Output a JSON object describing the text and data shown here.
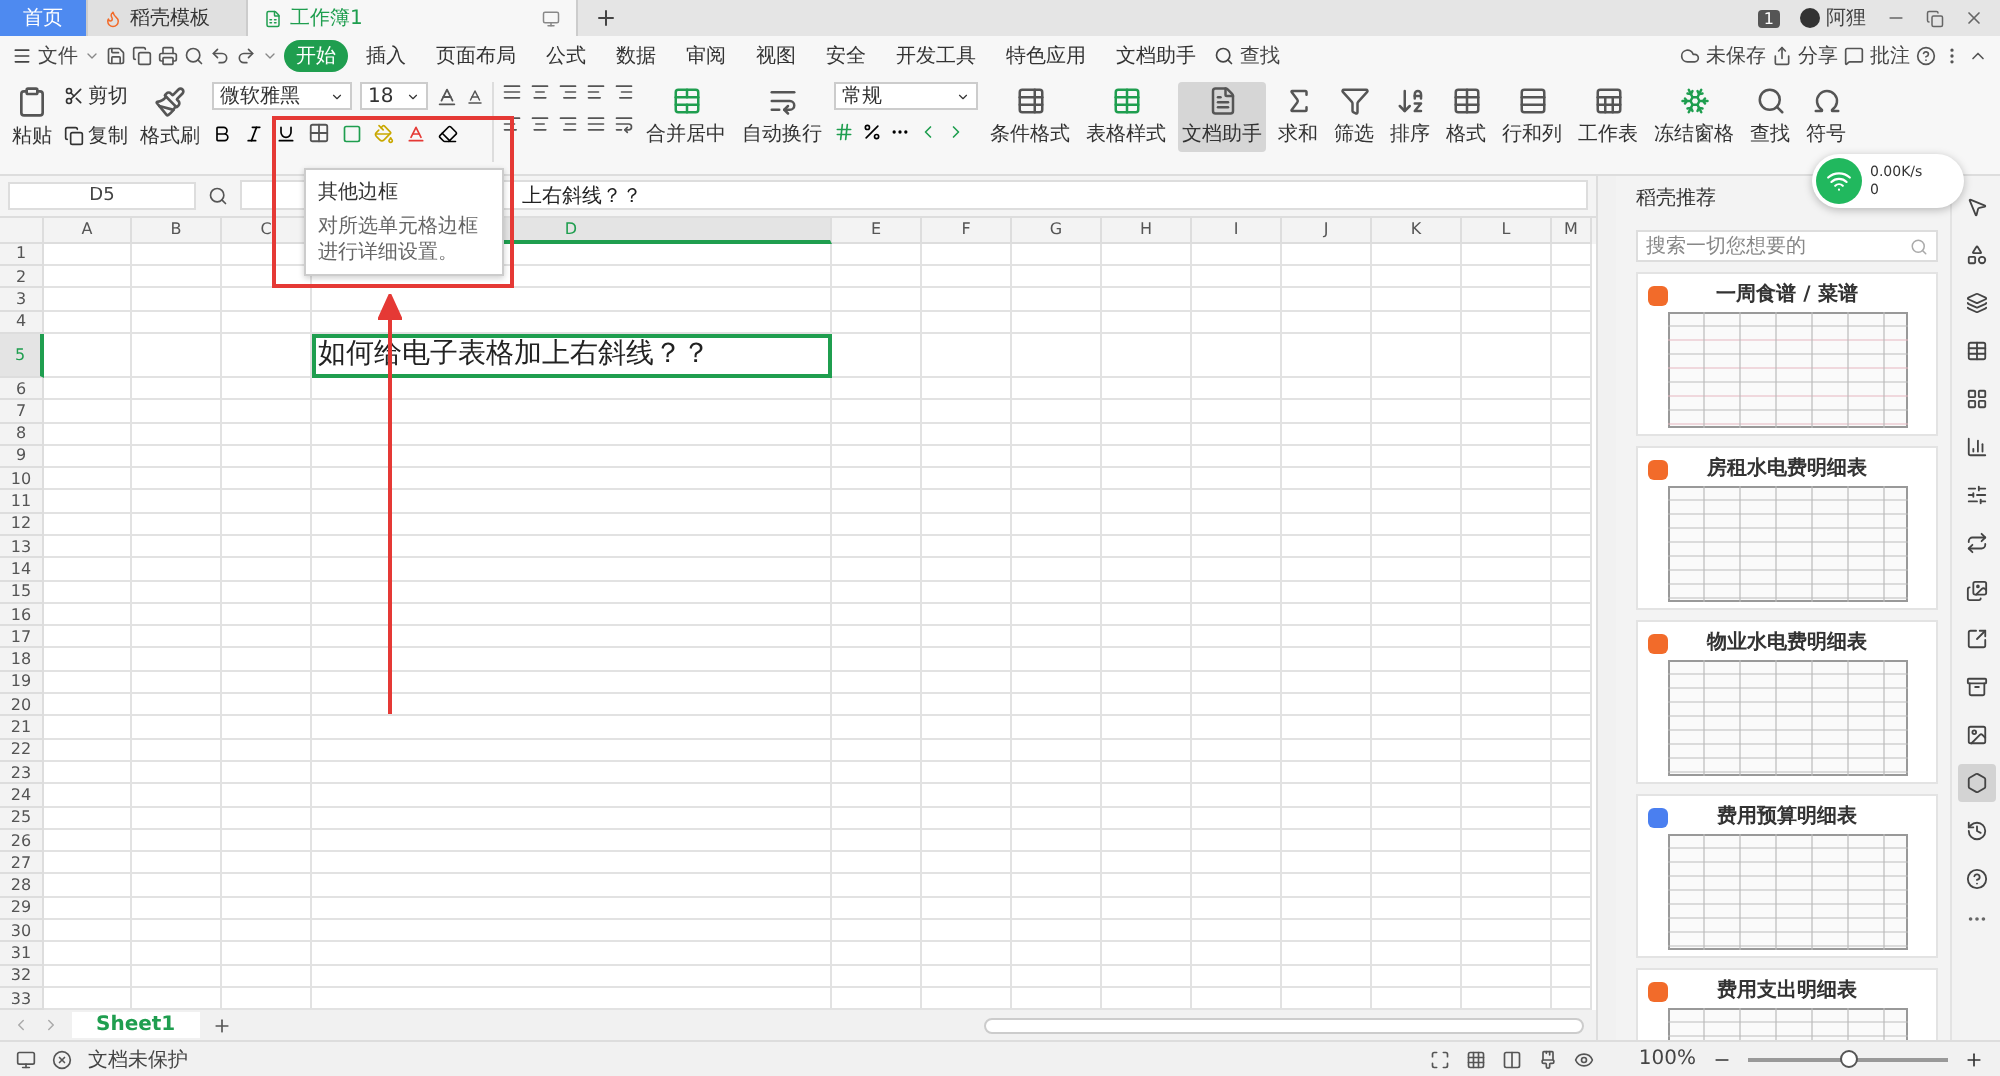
{
  "tabs": [
    {
      "label": "首页",
      "kind": "home",
      "selected": false
    },
    {
      "label": "稻壳模板",
      "kind": "docer",
      "selected": false
    },
    {
      "label": "工作簿1",
      "kind": "sheet",
      "selected": true
    }
  ],
  "account": {
    "badge": "1",
    "user": "阿狸"
  },
  "menu": {
    "file": "文件",
    "items": [
      {
        "label": "开始",
        "selected": true
      },
      {
        "label": "插入",
        "selected": false
      },
      {
        "label": "页面布局",
        "selected": false
      },
      {
        "label": "公式",
        "selected": false
      },
      {
        "label": "数据",
        "selected": false
      },
      {
        "label": "审阅",
        "selected": false
      },
      {
        "label": "视图",
        "selected": false
      },
      {
        "label": "安全",
        "selected": false
      },
      {
        "label": "开发工具",
        "selected": false
      },
      {
        "label": "特色应用",
        "selected": false
      },
      {
        "label": "文档助手",
        "selected": false
      }
    ],
    "search": "查找",
    "save_state": "未保存",
    "share": "分享",
    "comment": "批注"
  },
  "ribbon": {
    "paste": "粘贴",
    "cut": "剪切",
    "copy": "复制",
    "painter": "格式刷",
    "font_family": "微软雅黑",
    "font_size": "18",
    "merge": "合并居中",
    "wrap": "自动换行",
    "number_format": "常规",
    "tools": [
      {
        "label": "条件格式",
        "selected": false
      },
      {
        "label": "表格样式",
        "selected": false
      },
      {
        "label": "文档助手",
        "selected": true
      },
      {
        "label": "求和",
        "selected": false
      },
      {
        "label": "筛选",
        "selected": false
      },
      {
        "label": "排序",
        "selected": false
      },
      {
        "label": "格式",
        "selected": false
      },
      {
        "label": "行和列",
        "selected": false
      },
      {
        "label": "工作表",
        "selected": false
      },
      {
        "label": "冻结窗格",
        "selected": false
      },
      {
        "label": "查找",
        "selected": false
      },
      {
        "label": "符号",
        "selected": false
      }
    ]
  },
  "tooltip": {
    "title": "其他边框",
    "body": "对所选单元格边框进行详细设置。"
  },
  "network": {
    "speed": "0.00K/s",
    "count": "0"
  },
  "formula_bar": {
    "name_box": "D5",
    "value": "上右斜线？？"
  },
  "sheet": {
    "columns": [
      {
        "label": "A",
        "selected": false
      },
      {
        "label": "B",
        "selected": false
      },
      {
        "label": "C",
        "selected": false
      },
      {
        "label": "D",
        "selected": true
      },
      {
        "label": "E",
        "selected": false
      },
      {
        "label": "F",
        "selected": false
      },
      {
        "label": "G",
        "selected": false
      },
      {
        "label": "H",
        "selected": false
      },
      {
        "label": "I",
        "selected": false
      },
      {
        "label": "J",
        "selected": false
      },
      {
        "label": "K",
        "selected": false
      },
      {
        "label": "L",
        "selected": false
      },
      {
        "label": "M",
        "selected": false
      }
    ],
    "rows": [
      {
        "label": "1",
        "selected": false
      },
      {
        "label": "2",
        "selected": false
      },
      {
        "label": "3",
        "selected": false
      },
      {
        "label": "4",
        "selected": false
      },
      {
        "label": "5",
        "selected": true,
        "cell": "如何给电子表格加上右斜线？？"
      },
      {
        "label": "6",
        "selected": false
      },
      {
        "label": "7",
        "selected": false
      },
      {
        "label": "8",
        "selected": false
      },
      {
        "label": "9",
        "selected": false
      },
      {
        "label": "10",
        "selected": false
      },
      {
        "label": "11",
        "selected": false
      },
      {
        "label": "12",
        "selected": false
      },
      {
        "label": "13",
        "selected": false
      },
      {
        "label": "14",
        "selected": false
      },
      {
        "label": "15",
        "selected": false
      },
      {
        "label": "16",
        "selected": false
      },
      {
        "label": "17",
        "selected": false
      },
      {
        "label": "18",
        "selected": false
      },
      {
        "label": "19",
        "selected": false
      },
      {
        "label": "20",
        "selected": false
      },
      {
        "label": "21",
        "selected": false
      },
      {
        "label": "22",
        "selected": false
      },
      {
        "label": "23",
        "selected": false
      },
      {
        "label": "24",
        "selected": false
      },
      {
        "label": "25",
        "selected": false
      },
      {
        "label": "26",
        "selected": false
      },
      {
        "label": "27",
        "selected": false
      },
      {
        "label": "28",
        "selected": false
      },
      {
        "label": "29",
        "selected": false
      },
      {
        "label": "30",
        "selected": false
      },
      {
        "label": "31",
        "selected": false
      },
      {
        "label": "32",
        "selected": false
      },
      {
        "label": "33",
        "selected": false
      }
    ],
    "tabs": [
      {
        "label": "Sheet1",
        "selected": true
      }
    ]
  },
  "panel": {
    "title": "稻壳推荐",
    "placeholder": "搜索一切您想要的",
    "cards": [
      {
        "title": "一周食谱 / 菜谱",
        "color": "#f26b2a"
      },
      {
        "title": "房租水电费明细表",
        "color": "#f26b2a"
      },
      {
        "title": "物业水电费明细表",
        "color": "#f26b2a"
      },
      {
        "title": "费用预算明细表",
        "color": "#4a7ff0"
      },
      {
        "title": "费用支出明细表",
        "color": "#f26b2a"
      }
    ]
  },
  "side_tools": [
    {
      "selected": false
    },
    {
      "selected": false
    },
    {
      "selected": false
    },
    {
      "selected": false
    },
    {
      "selected": false
    },
    {
      "selected": false
    },
    {
      "selected": false
    },
    {
      "selected": false
    },
    {
      "selected": false
    },
    {
      "selected": false
    },
    {
      "selected": false
    },
    {
      "selected": false
    },
    {
      "selected": true
    },
    {
      "selected": false
    },
    {
      "selected": false
    }
  ],
  "status_bar": {
    "protection": "文档未保护",
    "zoom": "100%",
    "level": 0.5
  }
}
